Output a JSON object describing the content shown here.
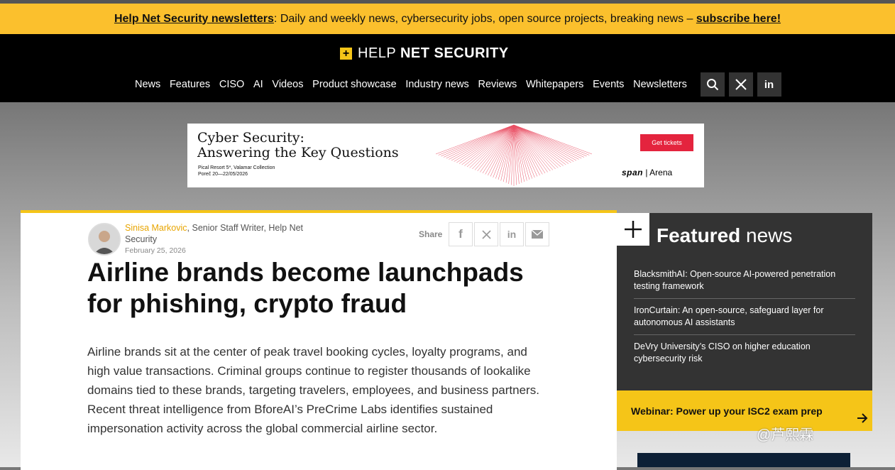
{
  "newsletter_bar": {
    "link_text": "Help Net Security newsletters",
    "text": ": Daily and weekly news, cybersecurity jobs, open source projects, breaking news – ",
    "cta": "subscribe here!"
  },
  "logo": {
    "box": "+",
    "light": "HELP",
    "bold": "NET SECURITY"
  },
  "nav": {
    "items": [
      "News",
      "Features",
      "CISO",
      "AI",
      "Videos",
      "Product showcase",
      "Industry news",
      "Reviews",
      "Whitepapers",
      "Events",
      "Newsletters"
    ],
    "icons": [
      "search-icon",
      "x-icon",
      "linkedin-icon"
    ]
  },
  "ad": {
    "title_line1": "Cyber Security:",
    "title_line2": "Answering the Key Questions",
    "venue": "Pical Resort 5*, Valamar Collection",
    "dates": "Poreč 20—22/05/2026",
    "button": "Get tickets",
    "brand_bold": "span",
    "brand_sep": " | ",
    "brand_light": "Arena",
    "accent": "#e4243e"
  },
  "article": {
    "author_name": "Sinisa Markovic",
    "author_role": ", Senior Staff Writer, Help Net Security",
    "date": "February 25, 2026",
    "share_label": "Share",
    "share_icons": [
      "facebook-icon",
      "x-icon",
      "linkedin-icon",
      "email-icon"
    ],
    "headline": "Airline brands become launchpads for phishing, crypto fraud",
    "lead": "Airline brands sit at the center of peak travel booking cycles, loyalty programs, and high value transactions. Criminal groups continue to register thousands of lookalike domains tied to these brands, targeting travelers, employees, and business partners. Recent threat intelligence from BforeAI’s PreCrime Labs identifies sustained impersonation activity across the global commercial airline sector."
  },
  "featured": {
    "title_bold": "Featured",
    "title_light": " news",
    "items": [
      "BlacksmithAI: Open-source AI-powered penetration testing framework",
      "IronCurtain: An open-source, safeguard layer for autonomous AI assistants",
      "DeVry University’s CISO on higher education cybersecurity risk"
    ]
  },
  "webinar": {
    "text": "Webinar: Power up your ISC2 exam prep"
  },
  "watermark": "@芦熙霖",
  "colors": {
    "accent_yellow": "#f5c518",
    "bar_yellow": "#fbc02d",
    "author_orange": "#e8a500"
  }
}
